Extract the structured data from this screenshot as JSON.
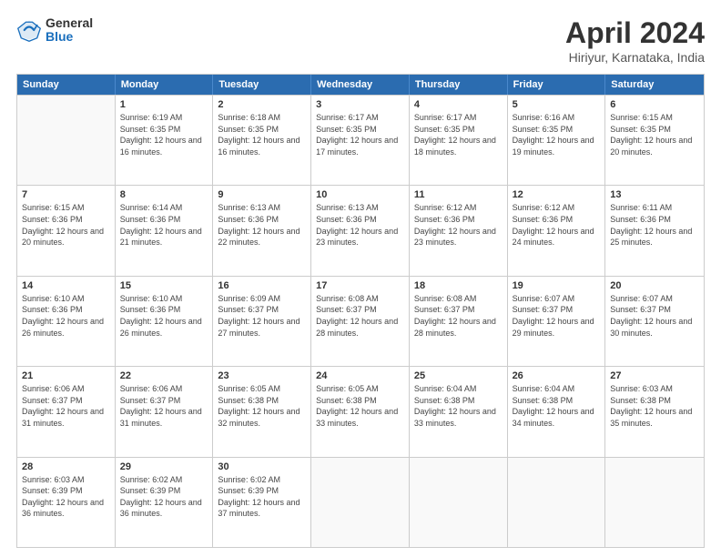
{
  "header": {
    "logo_general": "General",
    "logo_blue": "Blue",
    "month_title": "April 2024",
    "location": "Hiriyur, Karnataka, India"
  },
  "days": [
    "Sunday",
    "Monday",
    "Tuesday",
    "Wednesday",
    "Thursday",
    "Friday",
    "Saturday"
  ],
  "rows": [
    [
      {
        "day": "",
        "empty": true
      },
      {
        "day": "1",
        "sunrise": "6:19 AM",
        "sunset": "6:35 PM",
        "daylight": "12 hours and 16 minutes."
      },
      {
        "day": "2",
        "sunrise": "6:18 AM",
        "sunset": "6:35 PM",
        "daylight": "12 hours and 16 minutes."
      },
      {
        "day": "3",
        "sunrise": "6:17 AM",
        "sunset": "6:35 PM",
        "daylight": "12 hours and 17 minutes."
      },
      {
        "day": "4",
        "sunrise": "6:17 AM",
        "sunset": "6:35 PM",
        "daylight": "12 hours and 18 minutes."
      },
      {
        "day": "5",
        "sunrise": "6:16 AM",
        "sunset": "6:35 PM",
        "daylight": "12 hours and 19 minutes."
      },
      {
        "day": "6",
        "sunrise": "6:15 AM",
        "sunset": "6:35 PM",
        "daylight": "12 hours and 20 minutes."
      }
    ],
    [
      {
        "day": "7",
        "sunrise": "6:15 AM",
        "sunset": "6:36 PM",
        "daylight": "12 hours and 20 minutes."
      },
      {
        "day": "8",
        "sunrise": "6:14 AM",
        "sunset": "6:36 PM",
        "daylight": "12 hours and 21 minutes."
      },
      {
        "day": "9",
        "sunrise": "6:13 AM",
        "sunset": "6:36 PM",
        "daylight": "12 hours and 22 minutes."
      },
      {
        "day": "10",
        "sunrise": "6:13 AM",
        "sunset": "6:36 PM",
        "daylight": "12 hours and 23 minutes."
      },
      {
        "day": "11",
        "sunrise": "6:12 AM",
        "sunset": "6:36 PM",
        "daylight": "12 hours and 23 minutes."
      },
      {
        "day": "12",
        "sunrise": "6:12 AM",
        "sunset": "6:36 PM",
        "daylight": "12 hours and 24 minutes."
      },
      {
        "day": "13",
        "sunrise": "6:11 AM",
        "sunset": "6:36 PM",
        "daylight": "12 hours and 25 minutes."
      }
    ],
    [
      {
        "day": "14",
        "sunrise": "6:10 AM",
        "sunset": "6:36 PM",
        "daylight": "12 hours and 26 minutes."
      },
      {
        "day": "15",
        "sunrise": "6:10 AM",
        "sunset": "6:36 PM",
        "daylight": "12 hours and 26 minutes."
      },
      {
        "day": "16",
        "sunrise": "6:09 AM",
        "sunset": "6:37 PM",
        "daylight": "12 hours and 27 minutes."
      },
      {
        "day": "17",
        "sunrise": "6:08 AM",
        "sunset": "6:37 PM",
        "daylight": "12 hours and 28 minutes."
      },
      {
        "day": "18",
        "sunrise": "6:08 AM",
        "sunset": "6:37 PM",
        "daylight": "12 hours and 28 minutes."
      },
      {
        "day": "19",
        "sunrise": "6:07 AM",
        "sunset": "6:37 PM",
        "daylight": "12 hours and 29 minutes."
      },
      {
        "day": "20",
        "sunrise": "6:07 AM",
        "sunset": "6:37 PM",
        "daylight": "12 hours and 30 minutes."
      }
    ],
    [
      {
        "day": "21",
        "sunrise": "6:06 AM",
        "sunset": "6:37 PM",
        "daylight": "12 hours and 31 minutes."
      },
      {
        "day": "22",
        "sunrise": "6:06 AM",
        "sunset": "6:37 PM",
        "daylight": "12 hours and 31 minutes."
      },
      {
        "day": "23",
        "sunrise": "6:05 AM",
        "sunset": "6:38 PM",
        "daylight": "12 hours and 32 minutes."
      },
      {
        "day": "24",
        "sunrise": "6:05 AM",
        "sunset": "6:38 PM",
        "daylight": "12 hours and 33 minutes."
      },
      {
        "day": "25",
        "sunrise": "6:04 AM",
        "sunset": "6:38 PM",
        "daylight": "12 hours and 33 minutes."
      },
      {
        "day": "26",
        "sunrise": "6:04 AM",
        "sunset": "6:38 PM",
        "daylight": "12 hours and 34 minutes."
      },
      {
        "day": "27",
        "sunrise": "6:03 AM",
        "sunset": "6:38 PM",
        "daylight": "12 hours and 35 minutes."
      }
    ],
    [
      {
        "day": "28",
        "sunrise": "6:03 AM",
        "sunset": "6:39 PM",
        "daylight": "12 hours and 36 minutes."
      },
      {
        "day": "29",
        "sunrise": "6:02 AM",
        "sunset": "6:39 PM",
        "daylight": "12 hours and 36 minutes."
      },
      {
        "day": "30",
        "sunrise": "6:02 AM",
        "sunset": "6:39 PM",
        "daylight": "12 hours and 37 minutes."
      },
      {
        "day": "",
        "empty": true
      },
      {
        "day": "",
        "empty": true
      },
      {
        "day": "",
        "empty": true
      },
      {
        "day": "",
        "empty": true
      }
    ]
  ]
}
